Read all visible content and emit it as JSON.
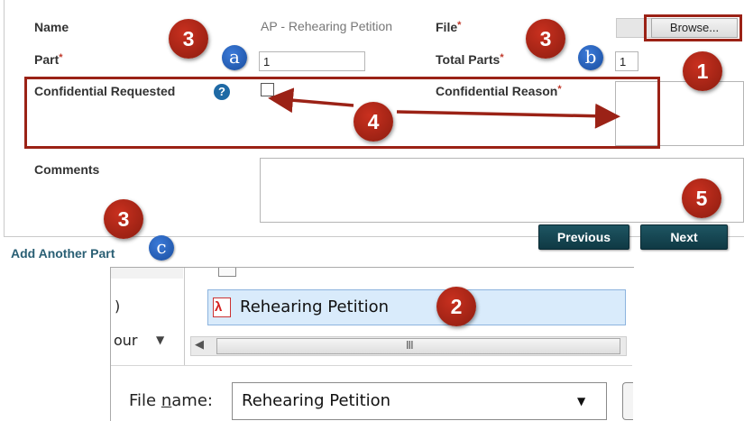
{
  "form": {
    "name_label": "Name",
    "name_value": "AP - Rehearing Petition",
    "file_label": "File",
    "required_mark": "*",
    "browse_label": "Browse...",
    "part_label": "Part",
    "part_value": "1",
    "total_parts_label": "Total Parts",
    "total_parts_value": "1",
    "confidential_requested_label": "Confidential Requested",
    "help_glyph": "?",
    "confidential_reason_label": "Confidential Reason",
    "comments_label": "Comments",
    "add_part_label": "Add Another Part",
    "previous_label": "Previous",
    "next_label": "Next",
    "confidential_checked": false
  },
  "callouts": {
    "one": "1",
    "two": "2",
    "three": "3",
    "four": "4",
    "five": "5",
    "a": "a",
    "b": "b",
    "c": "c"
  },
  "dialog": {
    "partial_left_top": ")",
    "partial_left_bottom": "our",
    "file_item": "Rehearing Petition",
    "file_icon": "pdf-file-icon",
    "scroll_thumb_glyph": "III",
    "file_name_prefix": "File ",
    "file_name_underlined": "n",
    "file_name_suffix": "ame:",
    "file_name_value": "Rehearing Petition"
  },
  "colors": {
    "callout_red": "#9b2216",
    "callout_blue": "#1f5fbf",
    "button_dark": "#164653",
    "link": "#2a5f74",
    "selected_row": "#d9ebfb"
  }
}
